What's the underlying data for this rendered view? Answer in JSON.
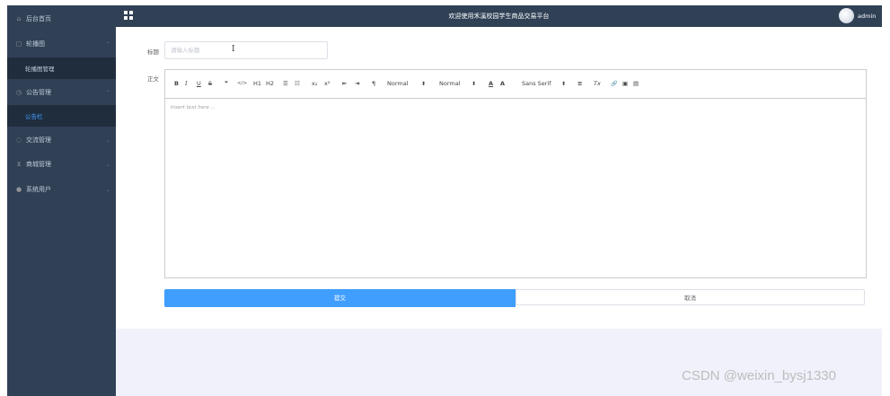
{
  "sidebar": {
    "items": [
      {
        "label": "后台首页",
        "icon": "home-icon"
      },
      {
        "label": "轮播图",
        "icon": "picture-icon",
        "submenu": [
          {
            "label": "轮播图管理"
          }
        ]
      },
      {
        "label": "公告管理",
        "icon": "clock-icon",
        "submenu": [
          {
            "label": "公告栏"
          }
        ]
      },
      {
        "label": "交流管理",
        "icon": "chat-icon"
      },
      {
        "label": "商城管理",
        "icon": "cart-icon"
      },
      {
        "label": "系统用户",
        "icon": "user-icon"
      }
    ]
  },
  "topbar": {
    "title": "欢迎使用禾溪校园学生商品交易平台",
    "username": "admin"
  },
  "form": {
    "title_label": "标题",
    "title_placeholder": "请输入标题",
    "body_label": "正文"
  },
  "editor": {
    "toolbar": {
      "bold": "B",
      "italic": "I",
      "underline": "U",
      "strike": "S",
      "quote": "❞",
      "code": "</>",
      "h1": "H1",
      "h2": "H2",
      "ordered_list": "☰",
      "bullet_list": "☷",
      "subscript": "x₂",
      "superscript": "x²",
      "outdent": "⇤",
      "indent": "⇥",
      "direction": "¶",
      "size_select": "Normal",
      "header_select": "Normal",
      "font_color": "A",
      "background_color": "A",
      "font_select": "Sans Serif",
      "align": "≡",
      "clean": "Tx",
      "link": "🔗",
      "image": "▣",
      "video": "▤"
    },
    "placeholder": "Insert text here ..."
  },
  "buttons": {
    "submit": "提交",
    "cancel": "取消"
  },
  "watermark": "CSDN @weixin_bysj1330",
  "colors": {
    "sidebar_bg": "#304156",
    "accent": "#409eff",
    "content_bg": "#f0f1fa"
  }
}
